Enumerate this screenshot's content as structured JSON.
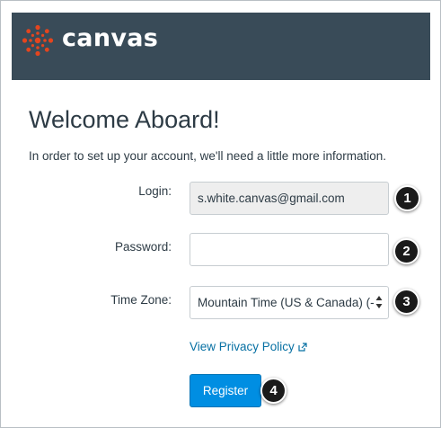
{
  "header": {
    "logo_text": "canvas",
    "logo_icon": "canvas-logo-icon",
    "background": "#394b58"
  },
  "page": {
    "title": "Welcome Aboard!",
    "intro": "In order to set up your account, we'll need a little more information."
  },
  "form": {
    "login_label": "Login:",
    "login_value": "s.white.canvas@gmail.com",
    "password_label": "Password:",
    "password_value": "",
    "timezone_label": "Time Zone:",
    "timezone_value": "Mountain Time (US & Canada) (-",
    "privacy_link": "View Privacy Policy",
    "privacy_link_icon": "external-link-icon",
    "register_label": "Register"
  },
  "callouts": [
    "1",
    "2",
    "3",
    "4"
  ],
  "colors": {
    "accent": "#008ee2",
    "link": "#0770a3",
    "text": "#2d3b45",
    "logo": "#e4451e"
  }
}
